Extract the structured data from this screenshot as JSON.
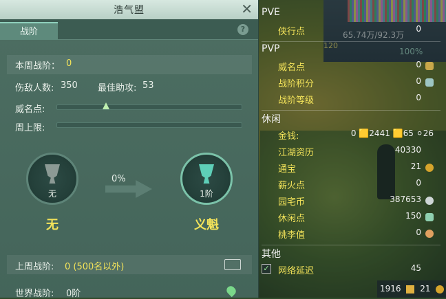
{
  "dialog": {
    "title": "浩气盟",
    "tab": "战阶",
    "help": "?",
    "weekly": {
      "label": "本周战阶：",
      "value": "0"
    },
    "kills": {
      "label": "伤敌人数:",
      "value": "350"
    },
    "assists": {
      "label": "最佳助攻:",
      "value": "53"
    },
    "fame_label": "威名点:",
    "week_cap_label": "周上限:",
    "progress_pct": "0%",
    "current": {
      "level": "无",
      "name": "无"
    },
    "next": {
      "level": "1阶",
      "name": "义魁"
    },
    "last_week": {
      "label": "上周战阶:",
      "value": "0 (500名以外)"
    },
    "world": {
      "label": "世界战阶:",
      "value": "0阶"
    }
  },
  "hud": {
    "top_level": "120",
    "hp": "65.74万/92.3万",
    "pct": "100%"
  },
  "panel": {
    "pve": {
      "head": "PVE",
      "rows": [
        {
          "k": "侠行点",
          "v": "0"
        }
      ]
    },
    "pvp": {
      "head": "PVP",
      "rows": [
        {
          "k": "威名点",
          "v": "0"
        },
        {
          "k": "战阶积分",
          "v": "0"
        },
        {
          "k": "战阶等级",
          "v": "0"
        }
      ]
    },
    "leisure": {
      "head": "休闲",
      "rows": [
        {
          "k": "金钱:",
          "v": "0 🟨2441 🟨65 ⚪26"
        },
        {
          "k": "江湖资历",
          "v": "40330"
        },
        {
          "k": "通宝",
          "v": "21"
        },
        {
          "k": "薪火点",
          "v": "0"
        },
        {
          "k": "园宅币",
          "v": "387653"
        },
        {
          "k": "休闲点",
          "v": "150"
        },
        {
          "k": "桃李值",
          "v": "0"
        }
      ]
    },
    "other": {
      "head": "其他",
      "rows": [
        {
          "k": "网络延迟",
          "v": "45"
        }
      ]
    }
  },
  "footer": {
    "a": "1916",
    "b": "21"
  },
  "colors": {
    "accent": "#f3e35a",
    "panel": "#4d6e62"
  }
}
